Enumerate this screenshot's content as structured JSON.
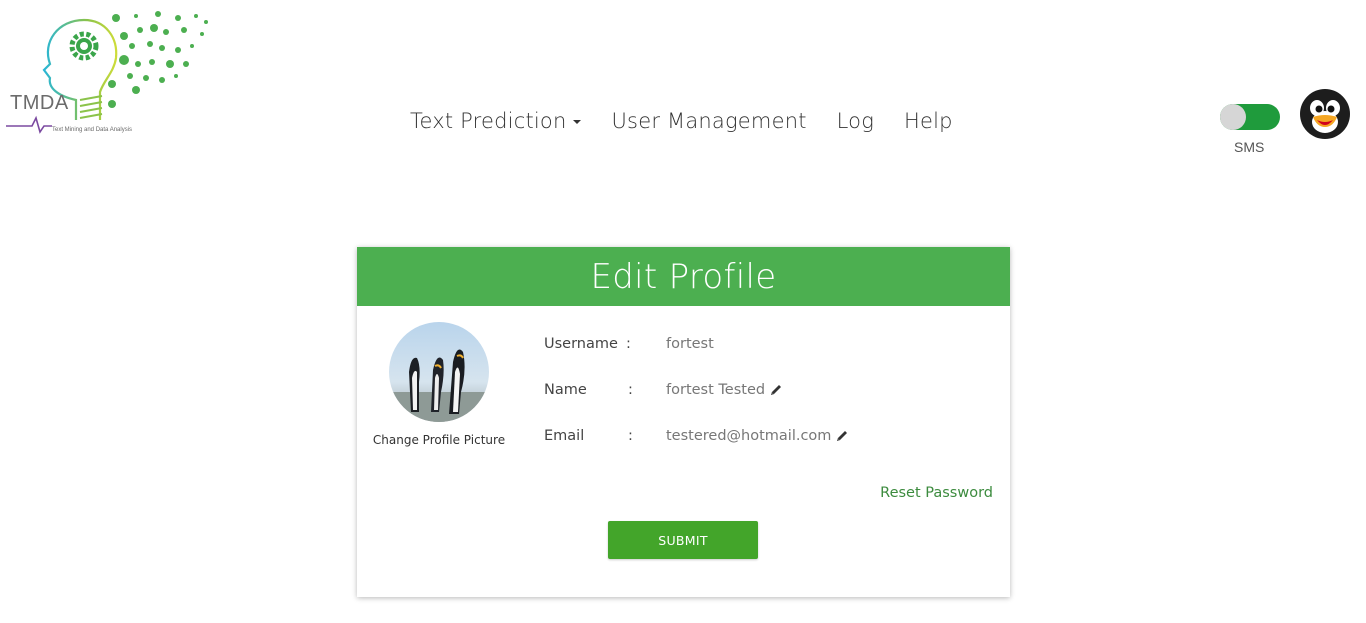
{
  "logo": {
    "name": "TMDA",
    "tagline": "Text Mining and Data Analysis"
  },
  "nav": {
    "items": [
      {
        "label": "Text Prediction"
      },
      {
        "label": "User Management"
      },
      {
        "label": "Log"
      },
      {
        "label": "Help"
      }
    ]
  },
  "toggle": {
    "label": "SMS",
    "on": true
  },
  "card": {
    "title": "Edit Profile",
    "change_picture": "Change Profile Picture",
    "fields": [
      {
        "label": "Username",
        "value": "fortest"
      },
      {
        "label": "Name",
        "value": "fortest Tested"
      },
      {
        "label": "Email",
        "value": "testered@hotmail.com"
      }
    ],
    "colon": ":",
    "reset_password": "Reset Password",
    "submit": "SUBMIT"
  },
  "colors": {
    "header_green": "#4caf50",
    "button_green": "#43a52a",
    "toggle_green": "#1f9b3c",
    "link_green": "#3c8b3e"
  }
}
